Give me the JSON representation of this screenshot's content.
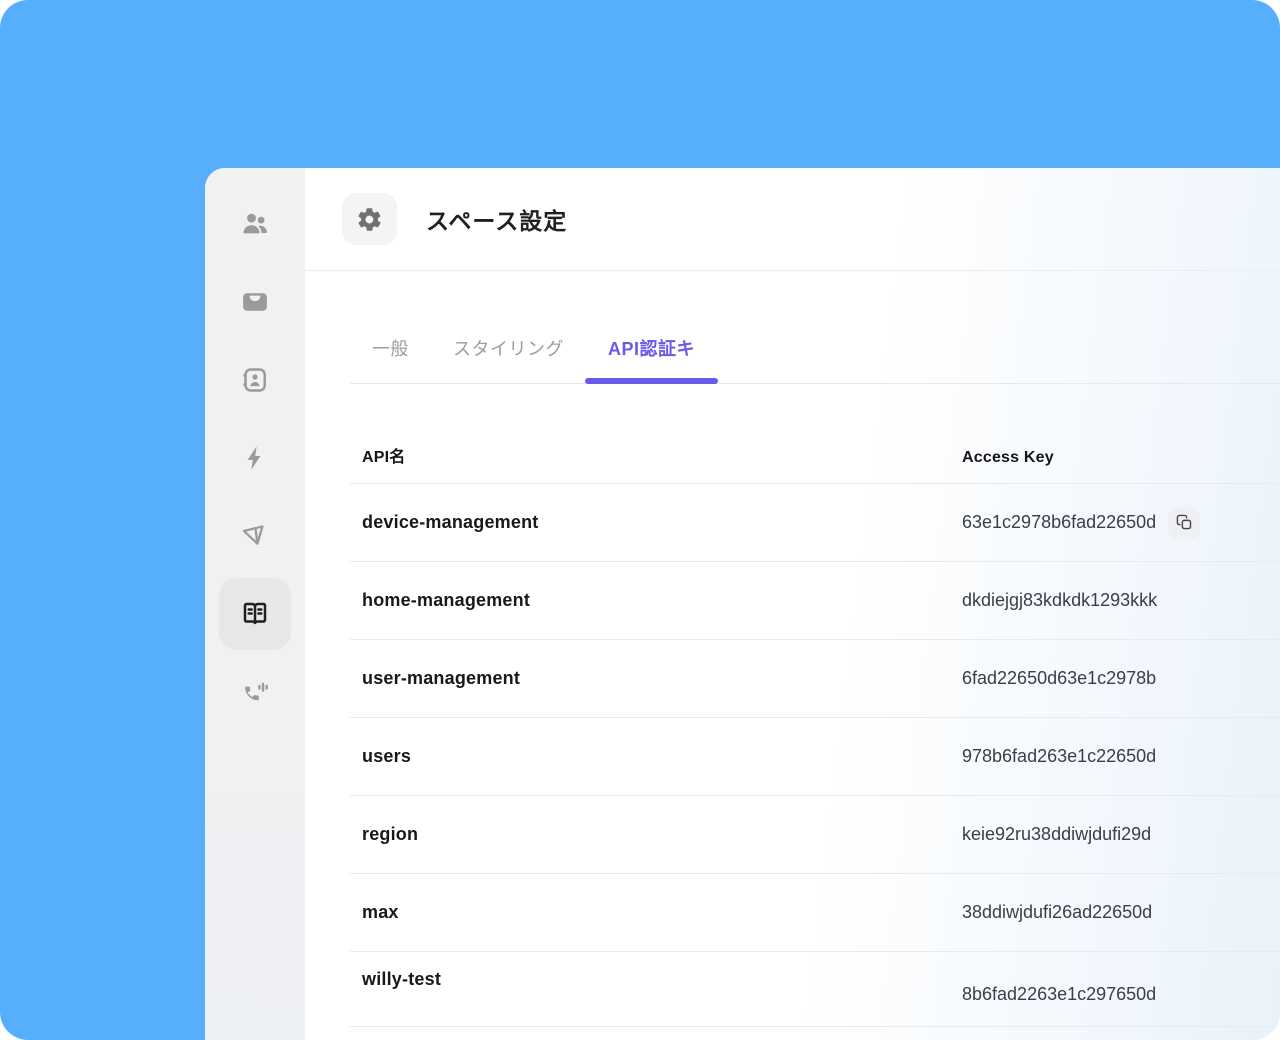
{
  "window": {
    "title": "スペース設定"
  },
  "sidebar": {
    "items": [
      {
        "icon": "people-icon",
        "active": false
      },
      {
        "icon": "inbox-icon",
        "active": false
      },
      {
        "icon": "contact-card-icon",
        "active": false
      },
      {
        "icon": "lightning-icon",
        "active": false
      },
      {
        "icon": "send-icon",
        "active": false
      },
      {
        "icon": "book-icon",
        "active": true
      },
      {
        "icon": "voice-call-icon",
        "active": false
      }
    ]
  },
  "tabs": {
    "items": [
      {
        "label": "一般",
        "active": false
      },
      {
        "label": "スタイリング",
        "active": false
      },
      {
        "label": "API認証キ",
        "active": true
      }
    ]
  },
  "table": {
    "columns": {
      "name": "API名",
      "key": "Access Key"
    },
    "rows": [
      {
        "name": "device-management",
        "key": "63e1c2978b6fad22650d",
        "has_copy_button": true
      },
      {
        "name": "home-management",
        "key": "dkdiejgj83kdkdk1293kkk",
        "has_copy_button": false
      },
      {
        "name": "user-management",
        "key": "6fad22650d63e1c2978b",
        "has_copy_button": false
      },
      {
        "name": "users",
        "key": "978b6fad263e1c22650d",
        "has_copy_button": false
      },
      {
        "name": "region",
        "key": "keie92ru38ddiwjdufi29d",
        "has_copy_button": false
      },
      {
        "name": "max",
        "key": "38ddiwjdufi26ad22650d",
        "has_copy_button": false
      },
      {
        "name": "willy-test",
        "key": "8b6fad2263e1c297650d",
        "has_copy_button": false
      }
    ]
  },
  "colors": {
    "background_blue": "#57AEFA",
    "accent_purple": "#6A5AE8",
    "sidebar_gray": "#F1F1F2",
    "sidebar_active_gray": "#E7E7E9",
    "icon_gray": "#9A9A9E",
    "row_border": "#EAEAED",
    "gradient_edge_blue": "#E9F2FA"
  }
}
